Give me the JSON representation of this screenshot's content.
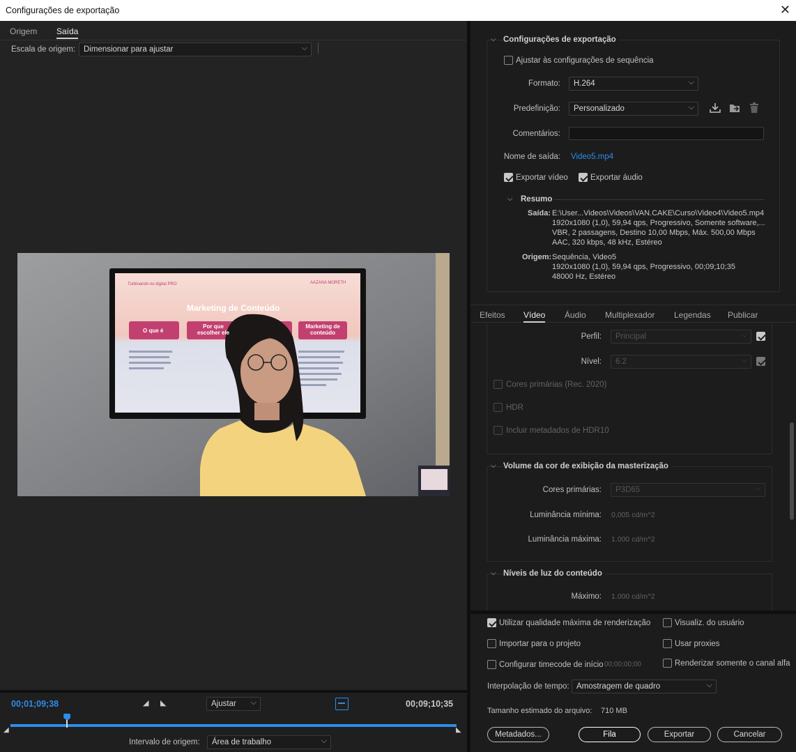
{
  "window": {
    "title": "Configurações de exportação",
    "close": "✕"
  },
  "left": {
    "tabs": [
      "Origem",
      "Saída"
    ],
    "source_scale_label": "Escala de origem:",
    "source_scale_value": "Dimensionar para ajustar",
    "preview": {
      "tv_header_left": "Turbinando no digital PRO",
      "tv_header_right": "AAZANA MORETH",
      "tv_title": "Marketing de Conteúdo",
      "tv_pills": [
        "O que é",
        "Por que escolher ele",
        "Marketing de conteúdo"
      ]
    },
    "timecode_current": "00;01;09;38",
    "fit_value": "Ajustar",
    "timecode_total": "00;09;10;35",
    "source_range_label": "Intervalo de origem:",
    "source_range_value": "Área de trabalho",
    "playhead_fraction": 0.127
  },
  "export_settings": {
    "section_title": "Configurações de exportação",
    "match_sequence": "Ajustar às configurações de sequência",
    "format_label": "Formato:",
    "format_value": "H.264",
    "preset_label": "Predefinição:",
    "preset_value": "Personalizado",
    "comments_label": "Comentários:",
    "output_name_label": "Nome de saída:",
    "output_name_value": "Video5.mp4",
    "export_video": "Exportar vídeo",
    "export_audio": "Exportar áudio",
    "summary_title": "Resumo",
    "output_label": "Saída:",
    "output_lines": [
      "E:\\User...Videos\\Videos\\VAN.CAKE\\Curso\\Video4\\Video5.mp4",
      "1920x1080 (1,0), 59,94 qps, Progressivo,  Somente software,...",
      "VBR, 2 passagens, Destino 10,00 Mbps, Máx. 500,00 Mbps",
      "AAC, 320 kbps, 48 kHz, Estéreo"
    ],
    "source_label": "Origem:",
    "source_lines": [
      "Sequência, Video5",
      "1920x1080 (1,0), 59,94  qps, Progressivo, 00;09;10;35",
      "48000 Hz, Estéreo"
    ]
  },
  "settings_tabs": [
    "Efeitos",
    "Vídeo",
    "Áudio",
    "Multiplexador",
    "Legendas",
    "Publicar"
  ],
  "video": {
    "profile_label": "Perfil:",
    "profile_value": "Principal",
    "level_label": "Nível:",
    "level_value": "6.2",
    "rec2020": "Cores primárias (Rec. 2020)",
    "hdr": "HDR",
    "hdr10": "Incluir metadados de HDR10",
    "mastering_title": "Volume da cor de exibição da masterização",
    "primaries_label": "Cores primárias:",
    "primaries_value": "P3D65",
    "min_lum_label": "Luminância mínima:",
    "min_lum_value": "0,005  cd/m^2",
    "max_lum_label": "Luminância máxima:",
    "max_lum_value": "1.000  cd/m^2",
    "light_title": "Níveis de luz do conteúdo",
    "max_label": "Máximo:",
    "max_value": "1.000  cd/m^2"
  },
  "bottom": {
    "max_quality": "Utilizar qualidade máxima de renderização",
    "user_preview": "Visualiz. do usuário",
    "import_project": "Importar para o projeto",
    "use_proxies": "Usar proxies",
    "start_timecode": "Configurar timecode de início",
    "start_timecode_value": "00;00;00;00",
    "alpha_only": "Renderizar somente o canal alfa",
    "time_interp_label": "Interpolação de tempo:",
    "time_interp_value": "Amostragem de quadro",
    "file_size_label": "Tamanho estimado do arquivo:",
    "file_size_value": "710 MB",
    "metadata_btn": "Metadados...",
    "queue_btn": "Fila",
    "export_btn": "Exportar",
    "cancel_btn": "Cancelar"
  },
  "colors": {
    "accent": "#2d8ceb",
    "background": "#1e1e1e"
  }
}
